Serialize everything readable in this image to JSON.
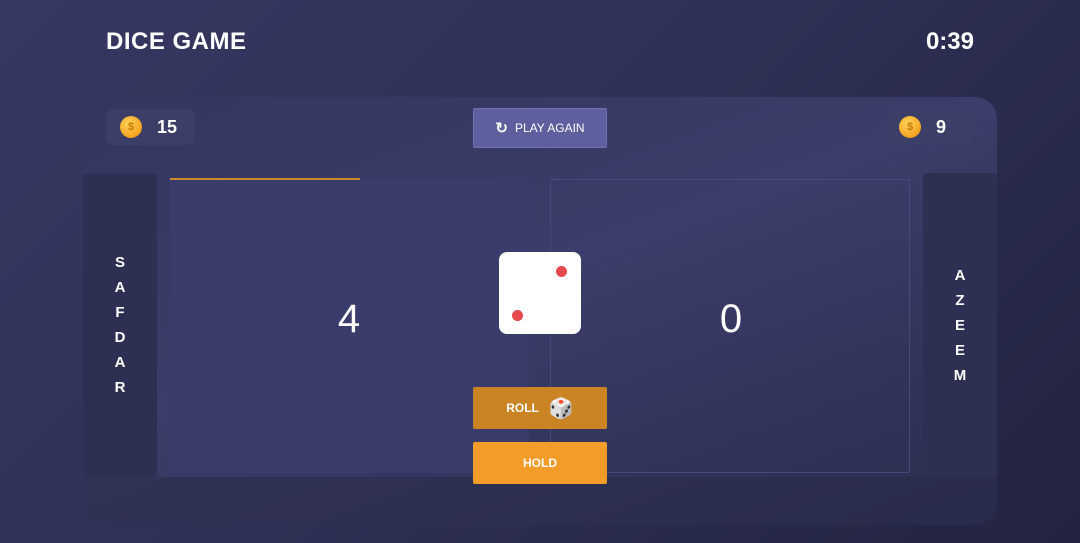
{
  "header": {
    "title": "DICE GAME",
    "timer": "0:39"
  },
  "players": {
    "left": {
      "name_letters": [
        "S",
        "A",
        "F",
        "D",
        "A",
        "R"
      ],
      "coins": "15",
      "score": "4",
      "active": true
    },
    "right": {
      "name_letters": [
        "A",
        "Z",
        "E",
        "E",
        "M"
      ],
      "coins": "9",
      "score": "0",
      "active": false
    }
  },
  "controls": {
    "play_again": "PLAY AGAIN",
    "roll": "ROLL",
    "hold": "HOLD"
  },
  "coin_symbol": "$",
  "die": {
    "value": 2
  },
  "colors": {
    "accent": "#f39c2a",
    "roll": "#cb8424",
    "pip": "#e5484d",
    "play_again": "#5d5f9e"
  },
  "icons": {
    "play_again": "refresh-icon",
    "roll": "hand-dice-icon",
    "coin": "coin-icon"
  }
}
